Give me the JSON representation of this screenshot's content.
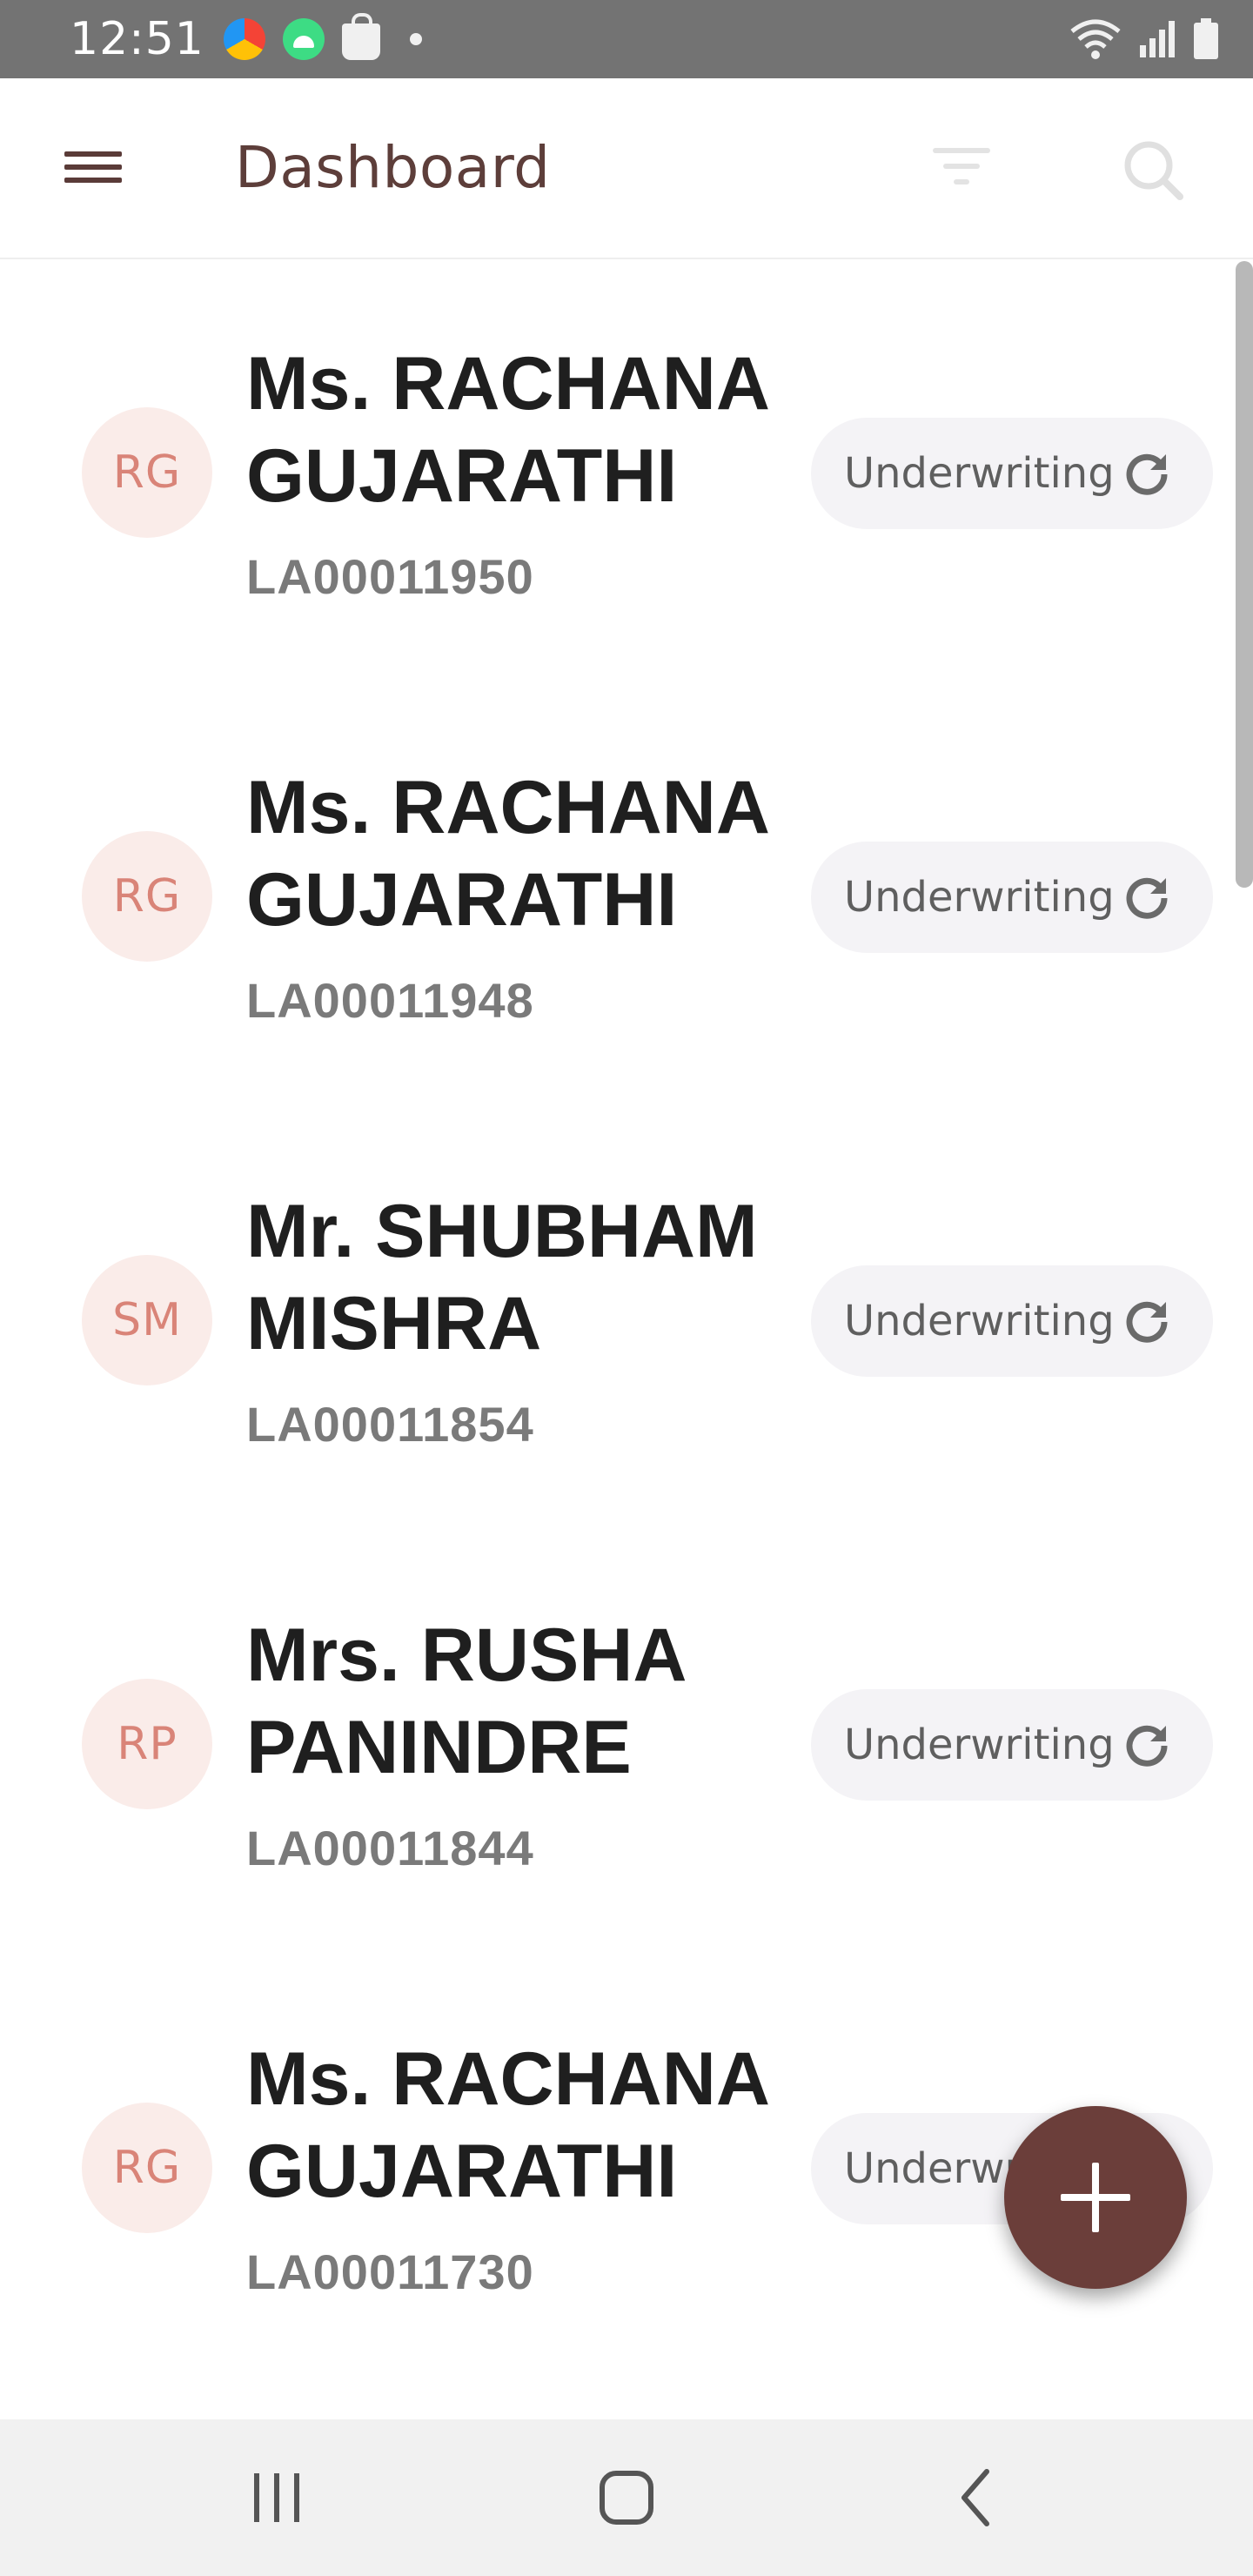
{
  "status_bar": {
    "time": "12:51"
  },
  "app_bar": {
    "title": "Dashboard",
    "menu_icon": "hamburger-menu-icon",
    "filter_icon": "filter-icon",
    "search_icon": "search-icon"
  },
  "items": [
    {
      "initials": "RG",
      "name": "Ms. RACHANA GUJARATHI",
      "id": "LA00011950",
      "status": "Underwriting"
    },
    {
      "initials": "RG",
      "name": "Ms. RACHANA GUJARATHI",
      "id": "LA00011948",
      "status": "Underwriting"
    },
    {
      "initials": "SM",
      "name": "Mr. SHUBHAM MISHRA",
      "id": "LA00011854",
      "status": "Underwriting"
    },
    {
      "initials": "RP",
      "name": "Mrs. RUSHA PANINDRE",
      "id": "LA00011844",
      "status": "Underwriting"
    },
    {
      "initials": "RG",
      "name": "Ms. RACHANA GUJARATHI",
      "id": "LA00011730",
      "status": "Underwriting"
    }
  ],
  "colors": {
    "brand": "#6b3e3a",
    "avatar_bg": "#faece9",
    "avatar_text": "#d98478",
    "chip_bg": "#f4f3f6"
  }
}
